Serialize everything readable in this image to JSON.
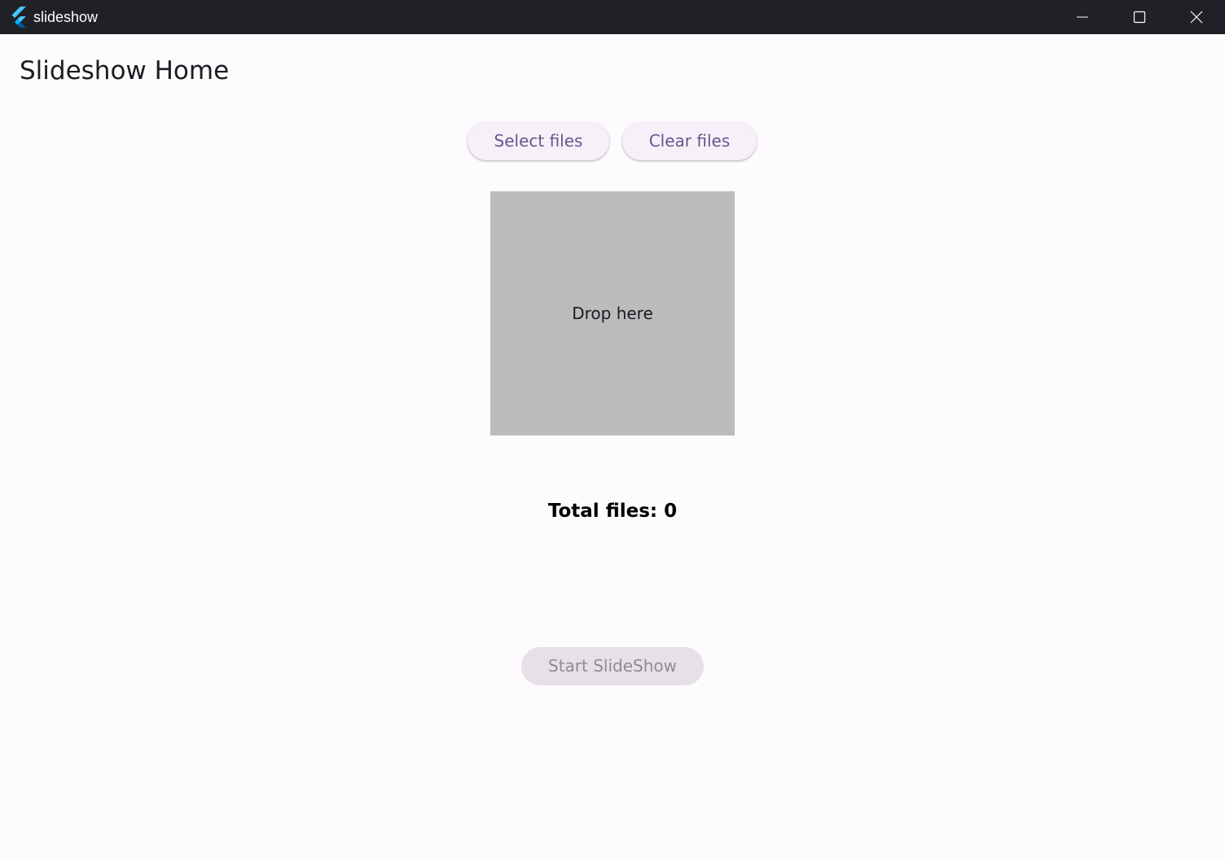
{
  "window": {
    "title": "slideshow",
    "controls": {
      "minimize": "minimize-icon",
      "maximize": "maximize-icon",
      "close": "close-icon"
    }
  },
  "page": {
    "title": "Slideshow Home"
  },
  "actions": {
    "select_label": "Select files",
    "clear_label": "Clear files",
    "start_label": "Start SlideShow",
    "start_disabled": true
  },
  "drop_zone": {
    "label": "Drop here"
  },
  "status": {
    "total_files_text": "Total files: 0"
  },
  "colors": {
    "titlebar": "#202027",
    "background": "#fefbfe",
    "accent": "#65558f",
    "drop_zone": "#bdbbbd",
    "disabled_text": "#8f8c92"
  }
}
